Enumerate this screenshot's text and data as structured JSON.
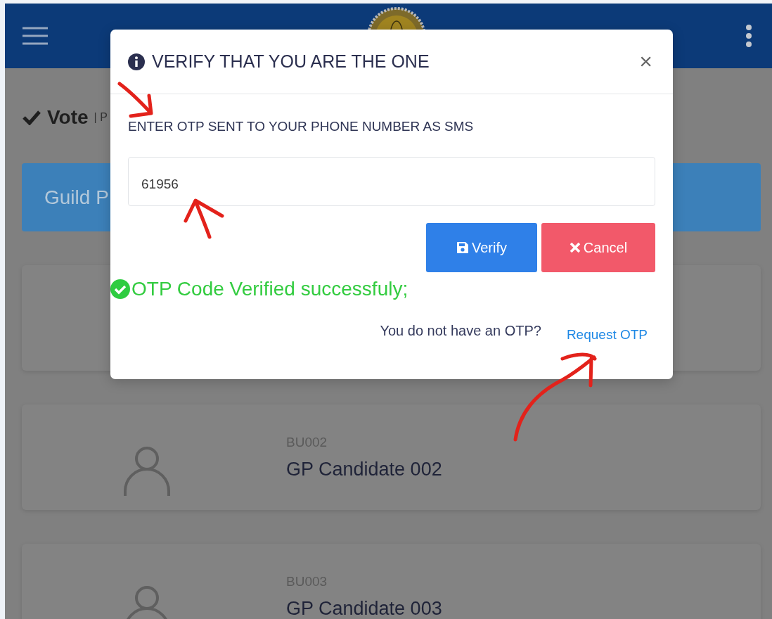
{
  "page": {
    "heading": "Vote",
    "heading_suffix": "| P",
    "banner": "Guild P",
    "candidates": [
      {
        "code": "BU002",
        "name": "GP Candidate 002"
      },
      {
        "code": "BU003",
        "name": "GP Candidate 003"
      }
    ]
  },
  "modal": {
    "title": "VERIFY THAT YOU ARE THE ONE",
    "close": "×",
    "prompt": "ENTER OTP SENT TO YOUR PHONE NUMBER AS SMS",
    "otp_field": {
      "value": "61956"
    },
    "buttons": [
      {
        "kind": "verify",
        "label": "Verify"
      },
      {
        "kind": "cancel",
        "label": "Cancel"
      }
    ],
    "status": {
      "kind": "success",
      "message": "OTP Code Verified successfuly;"
    },
    "footer": {
      "question": "You do not have an OTP?",
      "link": "Request OTP"
    }
  }
}
